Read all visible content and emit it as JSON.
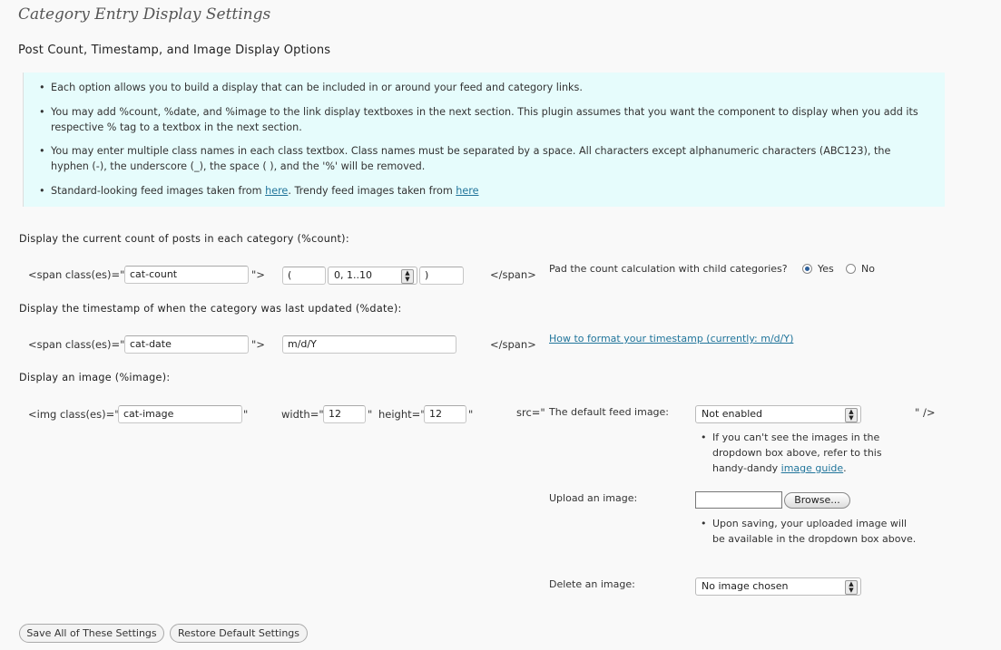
{
  "page_title": "Category Entry Display Settings",
  "section_title": "Post Count, Timestamp, and Image Display Options",
  "info": {
    "items": [
      "Each option allows you to build a display that can be included in or around your feed and category links.",
      "You may add %count, %date, and %image to the link display textboxes in the next section. This plugin assumes that you want the component to display when you add its respective % tag to a textbox in the next section.",
      "You may enter multiple class names in each class textbox. Class names must be separated by a space. All characters except alphanumeric characters (ABC123), the hyphen (-), the underscore (_), the space ( ), and the '%' will be removed."
    ],
    "item4_text1": "Standard-looking feed images taken from ",
    "item4_link1": "here",
    "item4_text2": ". Trendy feed images taken from ",
    "item4_link2": "here"
  },
  "count_section": {
    "label": "Display the current count of posts in each category (%count):",
    "span_open": "<span class(es)=\"",
    "class_value": "cat-count",
    "span_close_quote": "\">",
    "prefix_value": "(",
    "format_select": "0, 1..10",
    "suffix_value": ")",
    "span_end": "</span>",
    "pad_question": "Pad the count calculation with child categories?",
    "yes_label": "Yes",
    "no_label": "No",
    "selected": "Yes"
  },
  "date_section": {
    "label": "Display the timestamp of when the category was last updated (%date):",
    "span_open": "<span class(es)=\"",
    "class_value": "cat-date",
    "span_close_quote": "\">",
    "format_value": "m/d/Y",
    "span_end": "</span>",
    "help_link": "How to format your timestamp (currently: m/d/Y)"
  },
  "image_section": {
    "label": "Display an image (%image):",
    "img_open": "<img class(es)=\"",
    "class_value": "cat-image",
    "quote1": "\"",
    "width_label": "width=\"",
    "width_value": "12",
    "quote2": "\"",
    "height_label": "height=\"",
    "height_value": "12",
    "quote3": "\"",
    "src_label": "src=\"",
    "default_feed_label": "The default feed image:",
    "default_feed_select": "Not enabled",
    "img_end": "\" />",
    "note1_text": "If you can't see the images in the dropdown box above, refer to this handy-dandy ",
    "note1_link": "image guide",
    "note1_end": ".",
    "upload_label": "Upload an image:",
    "upload_value": "",
    "browse_label": "Browse...",
    "note2_text": "Upon saving, your uploaded image will be available in the dropdown box above.",
    "delete_label": "Delete an image:",
    "delete_select": "No image chosen"
  },
  "buttons": {
    "save": "Save All of These Settings",
    "restore": "Restore Default Settings"
  }
}
